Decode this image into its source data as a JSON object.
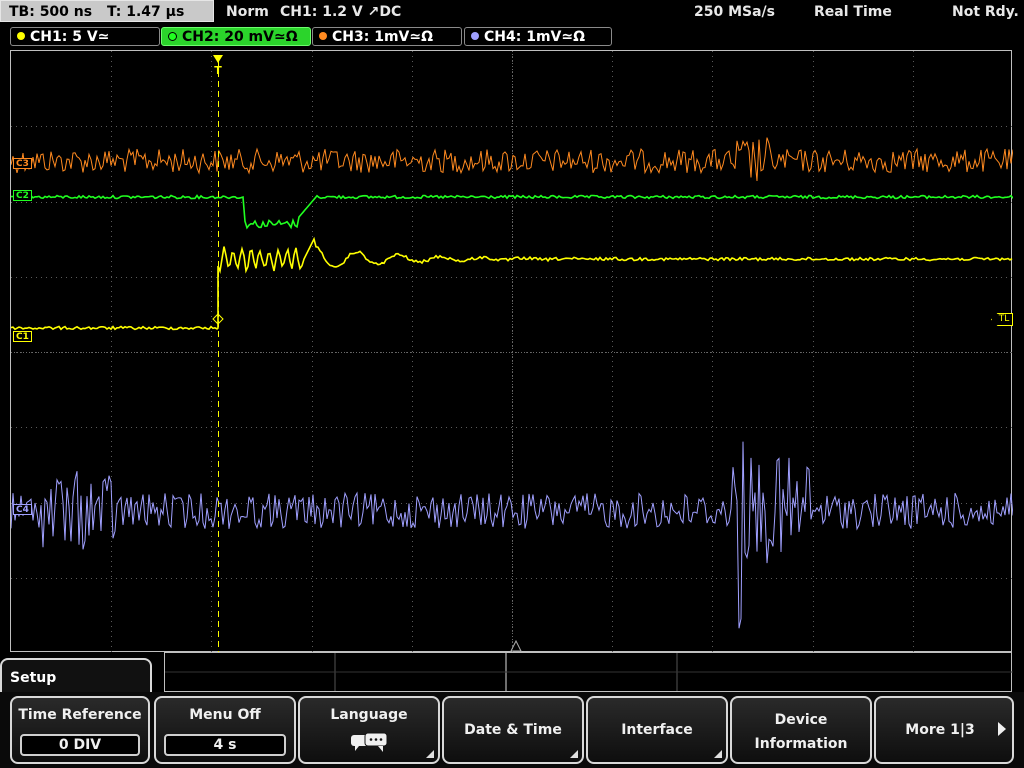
{
  "status_bar": {
    "timebase": "TB: 500 ns",
    "trigger_time": "T: 1.47 µs",
    "trigger_mode": "Norm",
    "trigger_info": "CH1: 1.2 V ↗DC",
    "sample_rate": "250 MSa/s",
    "acquisition_mode": "Real Time",
    "status": "Not Rdy."
  },
  "channels": [
    {
      "label": "CH1: 5 V≃",
      "color": "#ffff00",
      "active": false
    },
    {
      "label": "CH2: 20 mV≃Ω",
      "color": "#20ff20",
      "active": true
    },
    {
      "label": "CH3: 1mV≃Ω",
      "color": "#ff8a20",
      "active": false
    },
    {
      "label": "CH4: 1mV≃Ω",
      "color": "#a0a0ff",
      "active": false
    }
  ],
  "markers": {
    "c3": "C3",
    "c2": "C2",
    "c1": "C1",
    "c4": "C4",
    "trigger_level": "TL",
    "trigger_position": "T"
  },
  "menu": {
    "title": "Setup"
  },
  "softkeys": {
    "time_reference": {
      "label": "Time Reference",
      "value": "0 DIV"
    },
    "menu_off": {
      "label": "Menu Off",
      "value": "4 s"
    },
    "language": {
      "label": "Language",
      "icon": "speech-bubbles-icon"
    },
    "date_time": {
      "label": "Date & Time"
    },
    "interface": {
      "label": "Interface"
    },
    "device_information": {
      "label_line1": "Device",
      "label_line2": "Information"
    },
    "more": {
      "label": "More 1|3"
    }
  },
  "colors": {
    "ch1": "#ffff00",
    "ch2": "#20ff20",
    "ch3": "#ff8a20",
    "ch4": "#a0a0ff",
    "grid": "#5a5a5a"
  }
}
